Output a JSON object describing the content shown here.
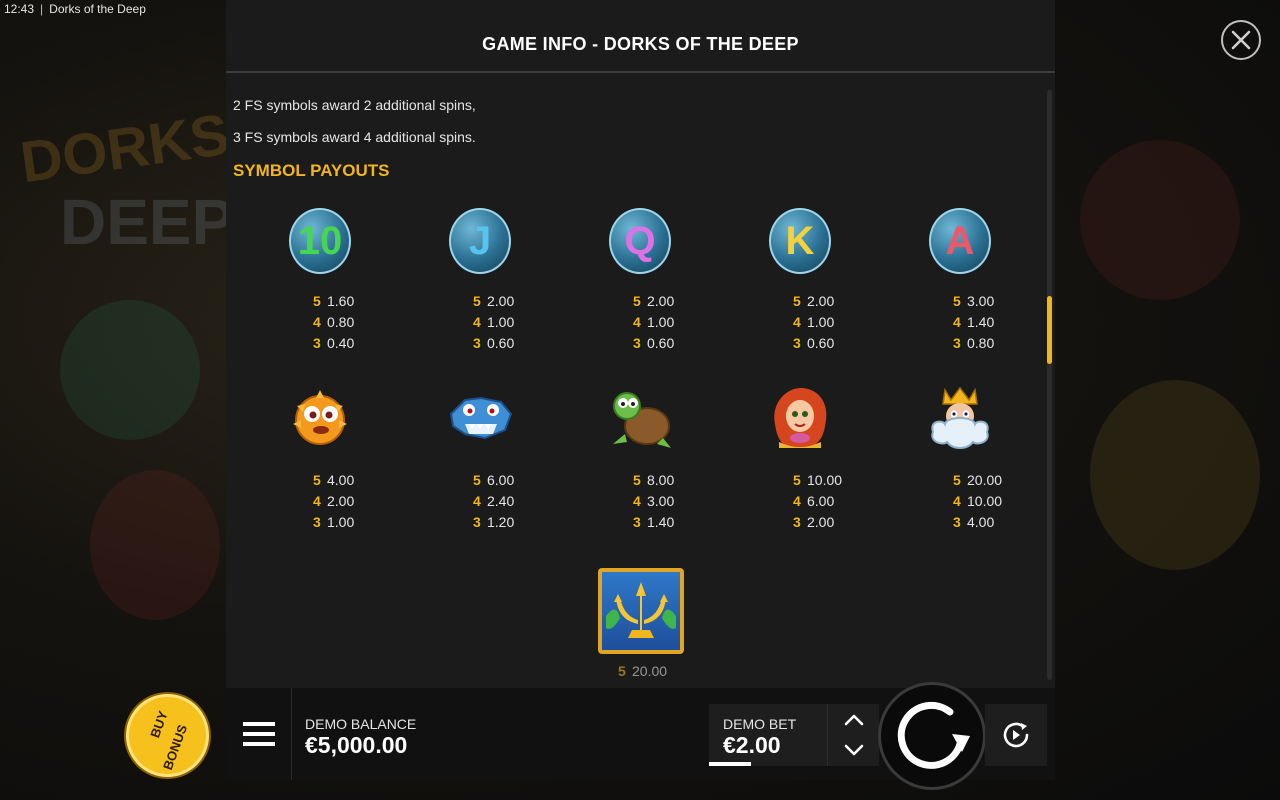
{
  "status_bar": {
    "time": "12:43",
    "separator": "|",
    "app_title": "Dorks of the Deep"
  },
  "panel": {
    "title": "GAME INFO - DORKS OF THE DEEP",
    "info_lines": [
      "2 FS symbols award 2 additional spins,",
      "3 FS symbols award 4 additional spins."
    ],
    "section_heading": "SYMBOL PAYOUTS",
    "low_symbols": [
      {
        "letter": "10",
        "color": "#46d651",
        "pays": [
          {
            "count": "5",
            "value": "1.60"
          },
          {
            "count": "4",
            "value": "0.80"
          },
          {
            "count": "3",
            "value": "0.40"
          }
        ]
      },
      {
        "letter": "J",
        "color": "#58c3f0",
        "pays": [
          {
            "count": "5",
            "value": "2.00"
          },
          {
            "count": "4",
            "value": "1.00"
          },
          {
            "count": "3",
            "value": "0.60"
          }
        ]
      },
      {
        "letter": "Q",
        "color": "#e070e8",
        "pays": [
          {
            "count": "5",
            "value": "2.00"
          },
          {
            "count": "4",
            "value": "1.00"
          },
          {
            "count": "3",
            "value": "0.60"
          }
        ]
      },
      {
        "letter": "K",
        "color": "#f5d13b",
        "pays": [
          {
            "count": "5",
            "value": "2.00"
          },
          {
            "count": "4",
            "value": "1.00"
          },
          {
            "count": "3",
            "value": "0.60"
          }
        ]
      },
      {
        "letter": "A",
        "color": "#f0566a",
        "pays": [
          {
            "count": "5",
            "value": "3.00"
          },
          {
            "count": "4",
            "value": "1.40"
          },
          {
            "count": "3",
            "value": "0.80"
          }
        ]
      }
    ],
    "high_symbols": [
      {
        "icon": "pufferfish-icon",
        "pays": [
          {
            "count": "5",
            "value": "4.00"
          },
          {
            "count": "4",
            "value": "2.00"
          },
          {
            "count": "3",
            "value": "1.00"
          }
        ]
      },
      {
        "icon": "shark-icon",
        "pays": [
          {
            "count": "5",
            "value": "6.00"
          },
          {
            "count": "4",
            "value": "2.40"
          },
          {
            "count": "3",
            "value": "1.20"
          }
        ]
      },
      {
        "icon": "turtle-icon",
        "pays": [
          {
            "count": "5",
            "value": "8.00"
          },
          {
            "count": "4",
            "value": "3.00"
          },
          {
            "count": "3",
            "value": "1.40"
          }
        ]
      },
      {
        "icon": "mermaid-icon",
        "pays": [
          {
            "count": "5",
            "value": "10.00"
          },
          {
            "count": "4",
            "value": "6.00"
          },
          {
            "count": "3",
            "value": "2.00"
          }
        ]
      },
      {
        "icon": "neptune-icon",
        "pays": [
          {
            "count": "5",
            "value": "20.00"
          },
          {
            "count": "4",
            "value": "10.00"
          },
          {
            "count": "3",
            "value": "4.00"
          }
        ]
      }
    ],
    "wild_symbol": {
      "icon": "trident-wild-icon",
      "pays": [
        {
          "count": "5",
          "value": "20.00"
        }
      ]
    }
  },
  "bottom_bar": {
    "balance_label": "DEMO BALANCE",
    "balance_value": "€5,000.00",
    "bet_label": "DEMO BET",
    "bet_value": "€2.00"
  },
  "buy_bonus": {
    "line1": "BUY",
    "line2": "BONUS"
  },
  "colors": {
    "accent": "#f2b51c",
    "panel_bg": "#1b1b1b",
    "bar_bg": "#111111"
  }
}
